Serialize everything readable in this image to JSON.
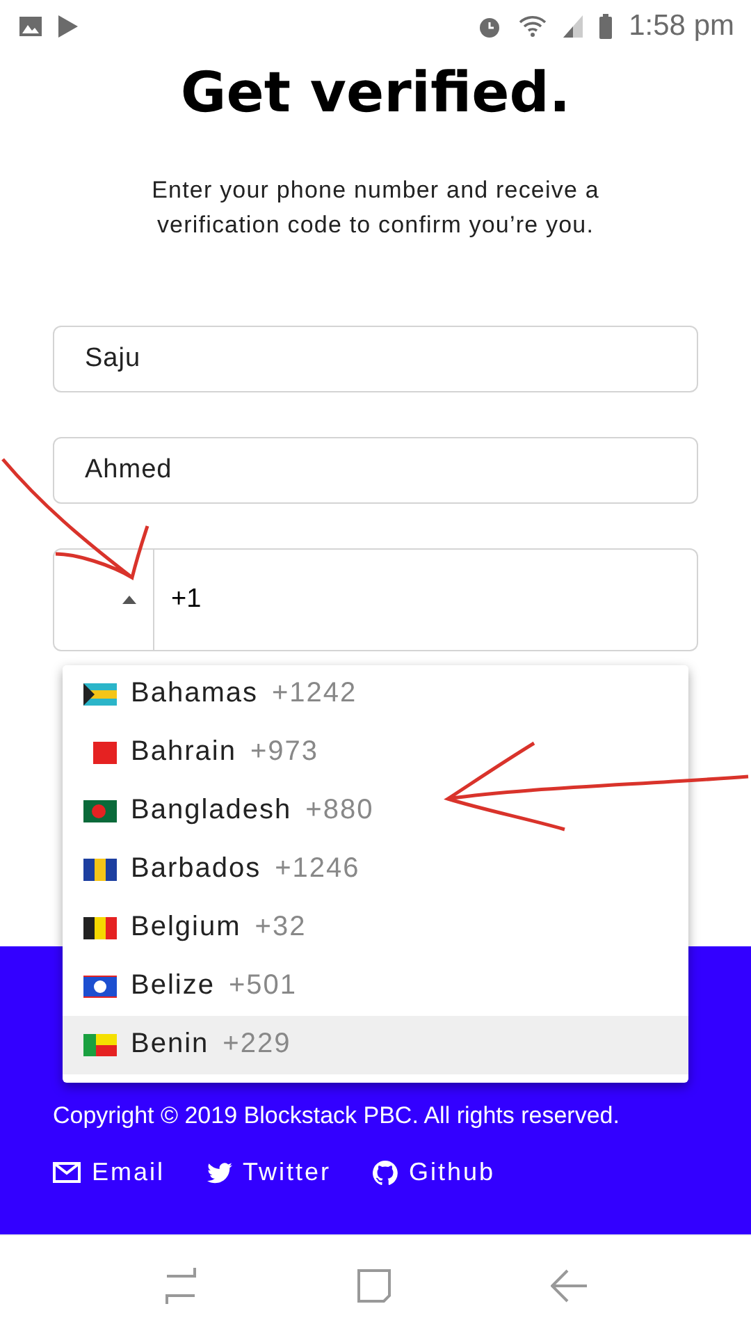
{
  "status_bar": {
    "time": "1:58 pm"
  },
  "title": "Get verified.",
  "subtitle": "Enter your phone number and receive a verification code to confirm you’re you.",
  "fields": [
    {
      "value": "Saju"
    },
    {
      "value": "Ahmed"
    }
  ],
  "phone": {
    "code": "+1",
    "dropdown_open": true
  },
  "countries": [
    {
      "name": "Bahamas",
      "code": "+1242",
      "selected": false
    },
    {
      "name": "Bahrain",
      "code": "+973",
      "selected": false
    },
    {
      "name": "Bangladesh",
      "code": "+880",
      "selected": false
    },
    {
      "name": "Barbados",
      "code": "+1246",
      "selected": false
    },
    {
      "name": "Belgium",
      "code": "+32",
      "selected": false
    },
    {
      "name": "Belize",
      "code": "+501",
      "selected": false
    },
    {
      "name": "Benin",
      "code": "+229",
      "selected": true
    }
  ],
  "footer": {
    "copyright": "Copyright © 2019 Blockstack PBC. All rights reserved.",
    "links": [
      {
        "kind": "email",
        "label": "Email"
      },
      {
        "kind": "twitter",
        "label": "Twitter"
      },
      {
        "kind": "github",
        "label": "Github"
      }
    ]
  }
}
